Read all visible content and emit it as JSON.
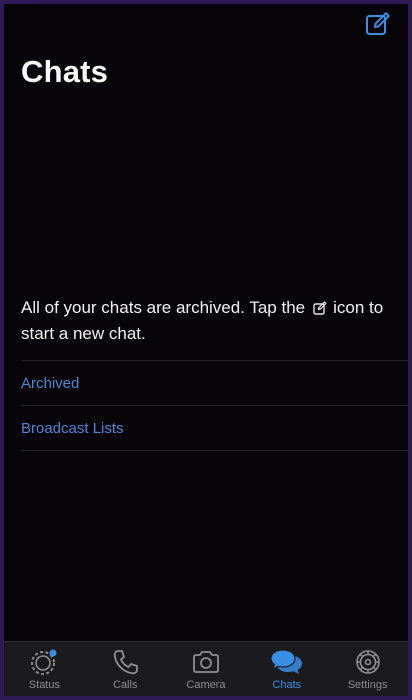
{
  "header": {
    "title": "Chats",
    "compose_icon": "compose-icon"
  },
  "empty_state": {
    "message_part1": "All of your chats are archived. Tap the",
    "message_part2": "icon to start a new chat.",
    "inline_icon": "compose-icon"
  },
  "list": {
    "items": [
      {
        "label": "Archived"
      },
      {
        "label": "Broadcast Lists"
      }
    ]
  },
  "tabbar": {
    "active": "Chats",
    "tabs": [
      {
        "label": "Status",
        "icon": "status-icon"
      },
      {
        "label": "Calls",
        "icon": "phone-icon"
      },
      {
        "label": "Camera",
        "icon": "camera-icon"
      },
      {
        "label": "Chats",
        "icon": "chat-bubbles-icon"
      },
      {
        "label": "Settings",
        "icon": "gear-icon"
      }
    ]
  },
  "colors": {
    "accent": "#3a8ee6",
    "link": "#4a8ad6",
    "background": "#060409",
    "tabbar": "#1b1b1e",
    "inactive": "#8e8e93"
  }
}
